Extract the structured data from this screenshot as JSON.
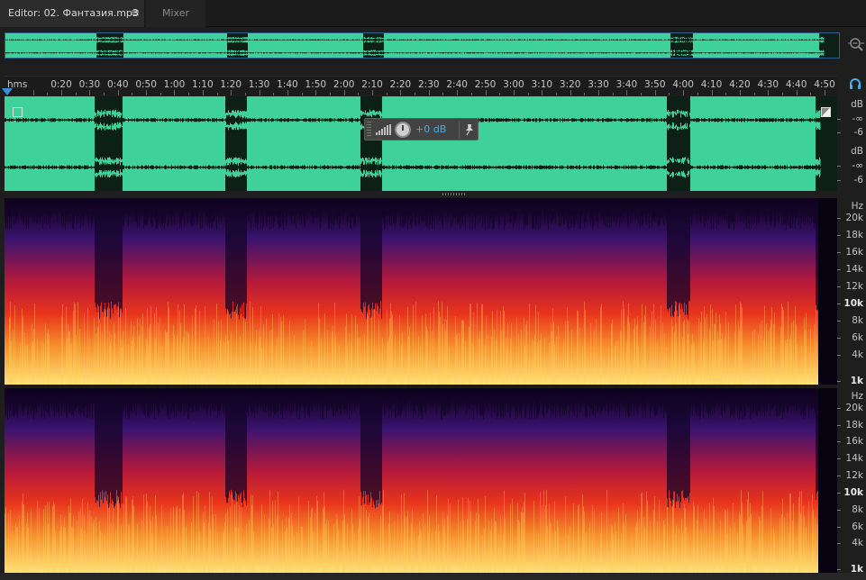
{
  "tabs": {
    "editor_label": "Editor: 02. Фантазия.mp3",
    "menu_icon": "≡",
    "mixer_label": "Mixer"
  },
  "ruler": {
    "unit_label": "hms",
    "labels": [
      "0:20",
      "0:30",
      "0:40",
      "0:50",
      "1:00",
      "1:10",
      "1:20",
      "1:30",
      "1:40",
      "1:50",
      "2:00",
      "2:10",
      "2:20",
      "2:30",
      "2:40",
      "2:50",
      "3:00",
      "3:10",
      "3:20",
      "3:30",
      "3:40",
      "3:50",
      "4:00",
      "4:10",
      "4:20",
      "4:30",
      "4:40",
      "4:50"
    ]
  },
  "hud": {
    "volume_value": "+0 dB",
    "pin_icon": "pin-icon"
  },
  "amplitude_scale": {
    "channel1": [
      "dB",
      "-∞",
      "-6"
    ],
    "channel2": [
      "dB",
      "-∞",
      "-6"
    ]
  },
  "frequency_scale": {
    "unit": "Hz",
    "labels": [
      "20k",
      "18k",
      "16k",
      "14k",
      "12k",
      "10k",
      "8k",
      "6k",
      "4k",
      "1k"
    ]
  },
  "colors": {
    "waveform_bg": "#3fd19a",
    "waveform_fg": "#0d2018",
    "accent": "#41b0ee",
    "spectral_high": "#ffe27a",
    "spectral_mid": "#e8341c",
    "spectral_low": "#3a1470"
  },
  "icons": [
    "menu-icon",
    "zoom-icon",
    "headphones-icon",
    "pin-icon",
    "volume-knob-icon",
    "level-meter-icon"
  ]
}
